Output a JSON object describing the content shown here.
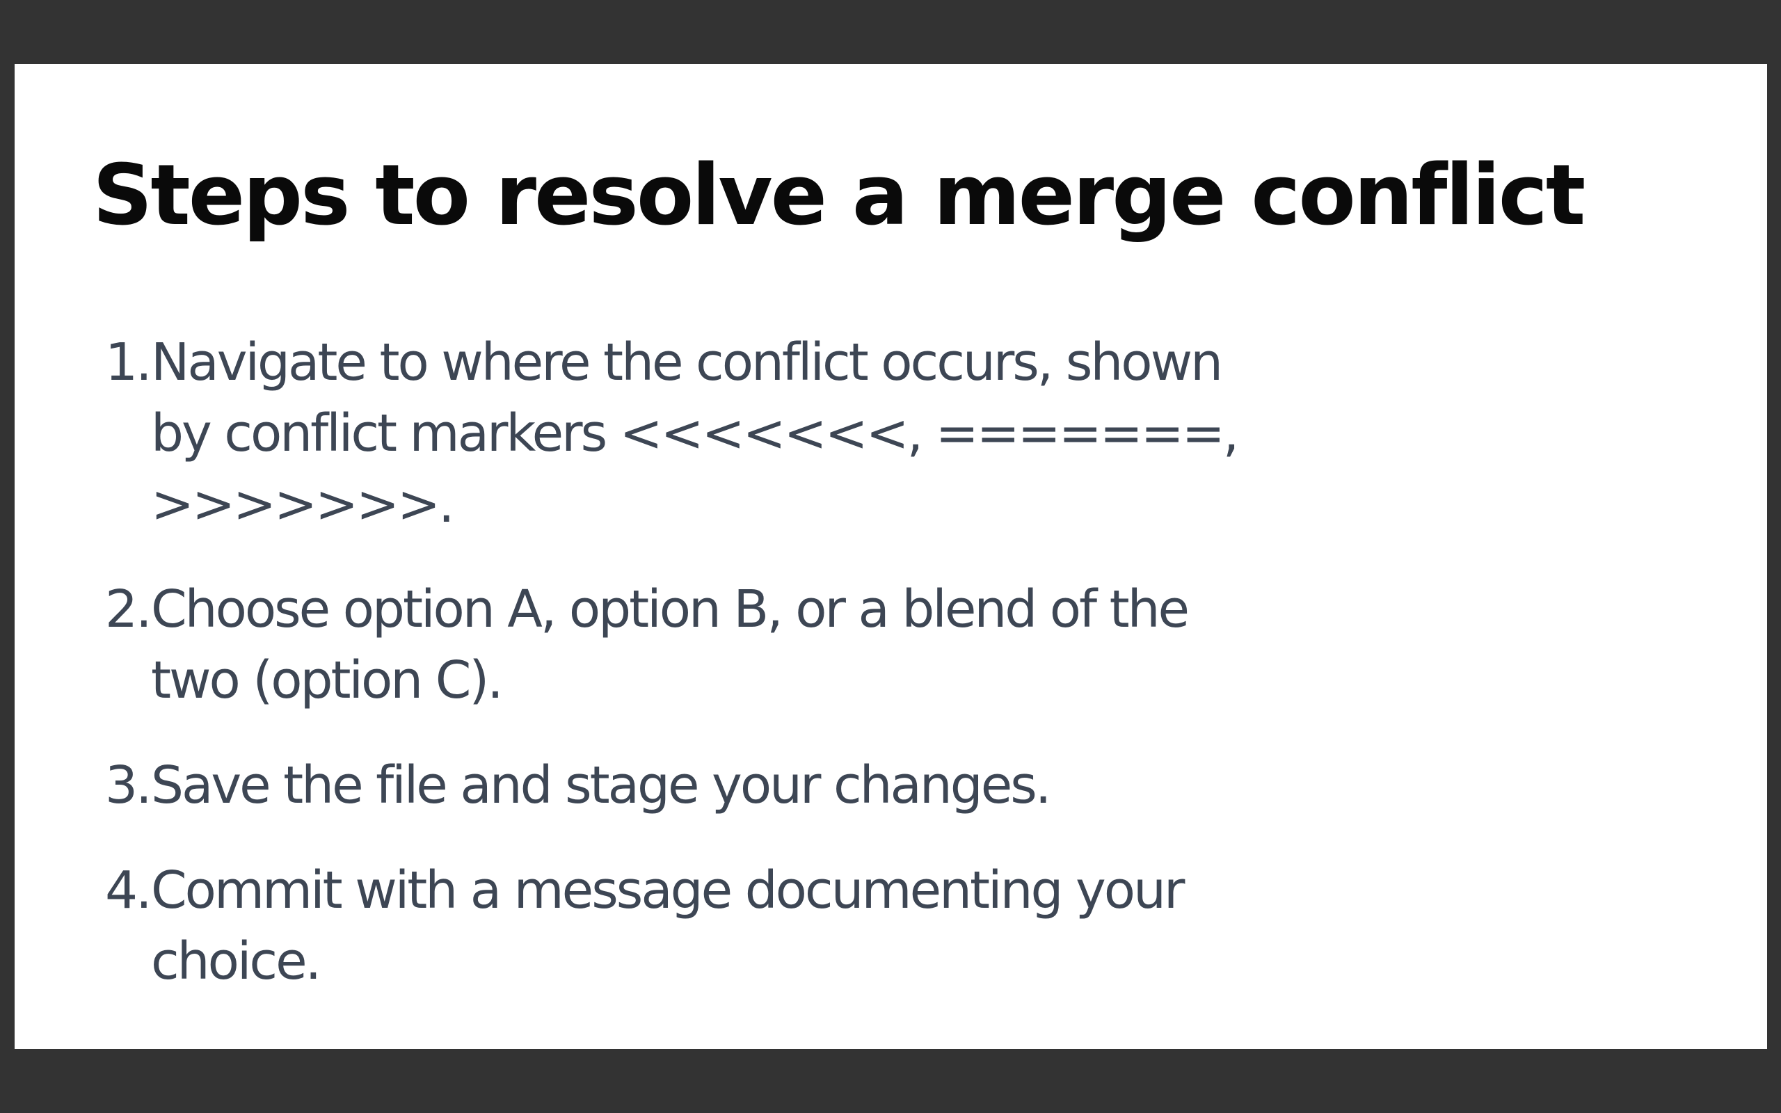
{
  "slide": {
    "title": "Steps to resolve a merge conflict",
    "steps": [
      {
        "number": "1.",
        "line1": "Navigate to where the conflict occurs, shown",
        "line2": "by conflict markers <<<<<<<, =======, >>>>>>>."
      },
      {
        "number": "2.",
        "line1": "Choose option A, option B, or a blend of the",
        "line2": "two (option C)."
      },
      {
        "number": "3.",
        "line1": "Save the file and stage your changes.",
        "line2": ""
      },
      {
        "number": "4.",
        "line1": "Commit with a message documenting your",
        "line2": "choice."
      }
    ]
  },
  "colors": {
    "backdrop": "#333333",
    "slide_background": "#ffffff",
    "title": "#0a0a0a",
    "body_text": "#3d4654"
  }
}
